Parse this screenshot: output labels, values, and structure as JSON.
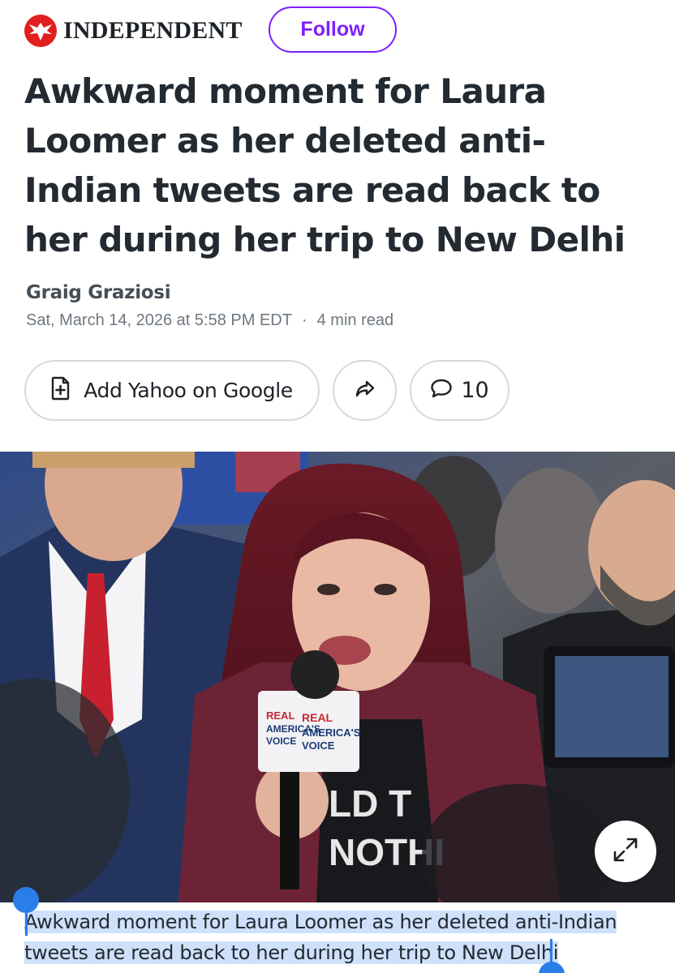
{
  "header": {
    "brand": "INDEPENDENT",
    "follow_label": "Follow"
  },
  "article": {
    "title": "Awkward moment for Laura Loomer as her deleted anti-Indian tweets are read back to her during her trip to New Delhi",
    "author": "Graig Graziosi",
    "date": "Sat, March 14, 2026 at 5:58 PM EDT",
    "read_time": "4 min read"
  },
  "actions": {
    "add_yahoo_label": "Add Yahoo on Google",
    "share_icon": "share-icon",
    "comment_count": "10"
  },
  "photo": {
    "mic_flag_text": "REAL AMERICA'S VOICE",
    "expand_icon": "expand-icon"
  },
  "caption": {
    "text": "Awkward moment for Laura Loomer as her deleted anti-Indian tweets are read back to her during her trip to New Delhi"
  },
  "colors": {
    "accent": "#7e1fff",
    "brand_red": "#e02020",
    "selection": "#cfe0fb",
    "selection_handle": "#2b7de9"
  }
}
